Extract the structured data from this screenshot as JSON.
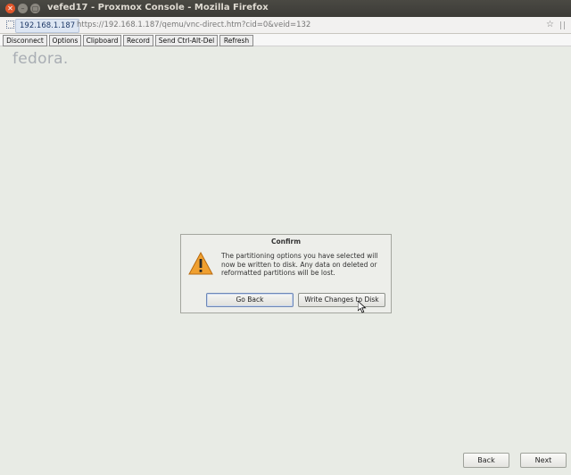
{
  "window": {
    "title": "vefed17 - Proxmox Console - Mozilla Firefox"
  },
  "urlbar": {
    "host": "192.168.1.187",
    "url": "https://192.168.1.187/qemu/vnc-direct.htm?cid=0&veid=132"
  },
  "toolbar": {
    "buttons": [
      "Disconnect",
      "Options",
      "Clipboard",
      "Record",
      "Send Ctrl-Alt-Del",
      "Refresh"
    ]
  },
  "installer": {
    "logo": "fedora",
    "back_label": "Back",
    "next_label": "Next"
  },
  "dialog": {
    "title": "Confirm",
    "message": "The partitioning options you have selected will now be written to disk.  Any data on deleted or reformatted partitions will be lost.",
    "go_back_label": "Go Back",
    "write_label": "Write Changes to Disk"
  },
  "colors": {
    "close_button": "#e0562b",
    "logo": "#a9aeb4",
    "warning": "#f0a030"
  }
}
